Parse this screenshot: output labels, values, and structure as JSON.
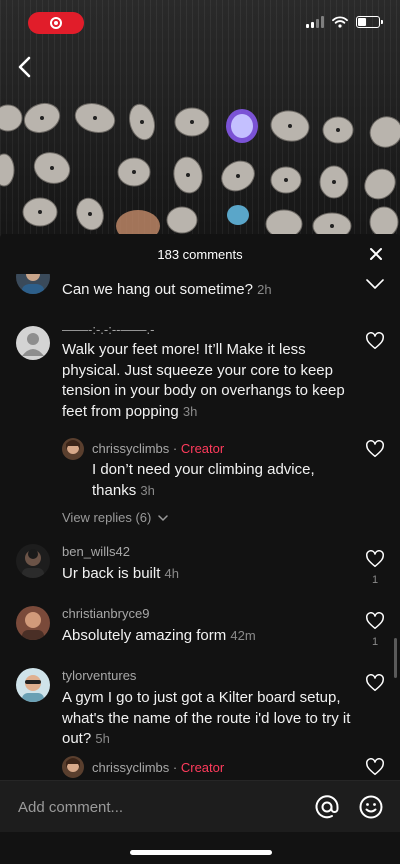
{
  "colors": {
    "accent": "#ff3b5c",
    "record": "#e11d2a",
    "sheet": "#121212"
  },
  "status_bar": {
    "record_icon": "record-icon",
    "signal_icon": "signal-icon",
    "wifi_icon": "wifi-icon",
    "battery_icon": "battery-icon"
  },
  "nav": {
    "back_icon": "chevron-left-icon"
  },
  "sheet": {
    "comment_count": "183 comments",
    "close_icon": "close-icon"
  },
  "comments": [
    {
      "username": "",
      "text": "Can we hang out sometime?",
      "time": "2h"
    },
    {
      "username": "——-:-.-:--——.-",
      "text": "Walk your feet more! It’ll Make it less physical. Just squeeze your core to keep tension in your body on overhangs to keep feet from popping",
      "time": "3h"
    },
    {
      "username": "chrissyclimbs",
      "separator": " · ",
      "badge": "Creator",
      "text": "I don’t need your climbing advice, thanks",
      "time": "3h"
    },
    {
      "view_replies": "View replies (6)"
    },
    {
      "username": "ben_wills42",
      "text": "Ur back is built",
      "time": "4h",
      "likes": "1"
    },
    {
      "username": "christianbryce9",
      "text": "Absolutely amazing form",
      "time": "42m",
      "likes": "1"
    },
    {
      "username": "tylorventures",
      "text": "A gym I go to just got a Kilter board setup, what's the name of the route i'd love to try it out?",
      "time": "5h"
    },
    {
      "username": "chrissyclimbs",
      "separator": " · ",
      "badge": "Creator"
    }
  ],
  "input": {
    "placeholder": "Add comment...",
    "mention_icon": "at-icon",
    "emoji_icon": "smiley-icon"
  }
}
